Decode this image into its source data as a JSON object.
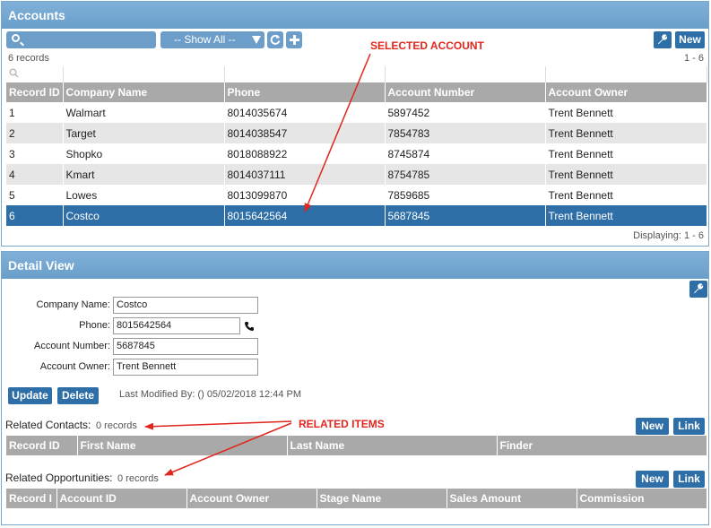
{
  "accounts": {
    "title": "Accounts",
    "show_all": "-- Show All --",
    "records_count": "6 records",
    "page_range": "1 - 6",
    "displaying": "Displaying: 1 - 6",
    "new_label": "New",
    "columns": [
      "Record ID",
      "Company Name",
      "Phone",
      "Account Number",
      "Account Owner"
    ],
    "rows": [
      [
        "1",
        "Walmart",
        "8014035674",
        "5897452",
        "Trent Bennett"
      ],
      [
        "2",
        "Target",
        "8014038547",
        "7854783",
        "Trent Bennett"
      ],
      [
        "3",
        "Shopko",
        "8018088922",
        "8745874",
        "Trent Bennett"
      ],
      [
        "4",
        "Kmart",
        "8014037111",
        "8754785",
        "Trent Bennett"
      ],
      [
        "5",
        "Lowes",
        "8013099870",
        "7859685",
        "Trent Bennett"
      ],
      [
        "6",
        "Costco",
        "8015642564",
        "5687845",
        "Trent Bennett"
      ]
    ],
    "selected_row": 6
  },
  "detail": {
    "title": "Detail View",
    "company_label": "Company Name:",
    "company_value": "Costco",
    "phone_label": "Phone:",
    "phone_value": "8015642564",
    "account_number_label": "Account Number:",
    "account_number_value": "5687845",
    "owner_label": "Account Owner:",
    "owner_value": "Trent Bennett",
    "update_label": "Update",
    "delete_label": "Delete",
    "last_modified": "Last Modified By: () 05/02/2018 12:44 PM"
  },
  "related_contacts": {
    "label": "Related Contacts:",
    "count": "0 records",
    "new_label": "New",
    "link_label": "Link",
    "columns": [
      "Record ID",
      "First Name",
      "Last Name",
      "Finder"
    ]
  },
  "related_opportunities": {
    "label": "Related Opportunities:",
    "count": "0 records",
    "new_label": "New",
    "link_label": "Link",
    "columns": [
      "Record I",
      "Account ID",
      "Account Owner",
      "Stage Name",
      "Sales Amount",
      "Commission"
    ]
  },
  "annotations": {
    "selected_account": "SELECTED ACCOUNT",
    "related_items": "RELATED ITEMS"
  },
  "icons": {
    "search": "search-icon",
    "refresh": "refresh-icon",
    "add": "plus-icon",
    "wrench": "wrench-icon",
    "phone": "phone-icon"
  },
  "colors": {
    "header": "#6a9fcb",
    "selected_row": "#2f6fa8",
    "annotation": "#e0261e"
  }
}
